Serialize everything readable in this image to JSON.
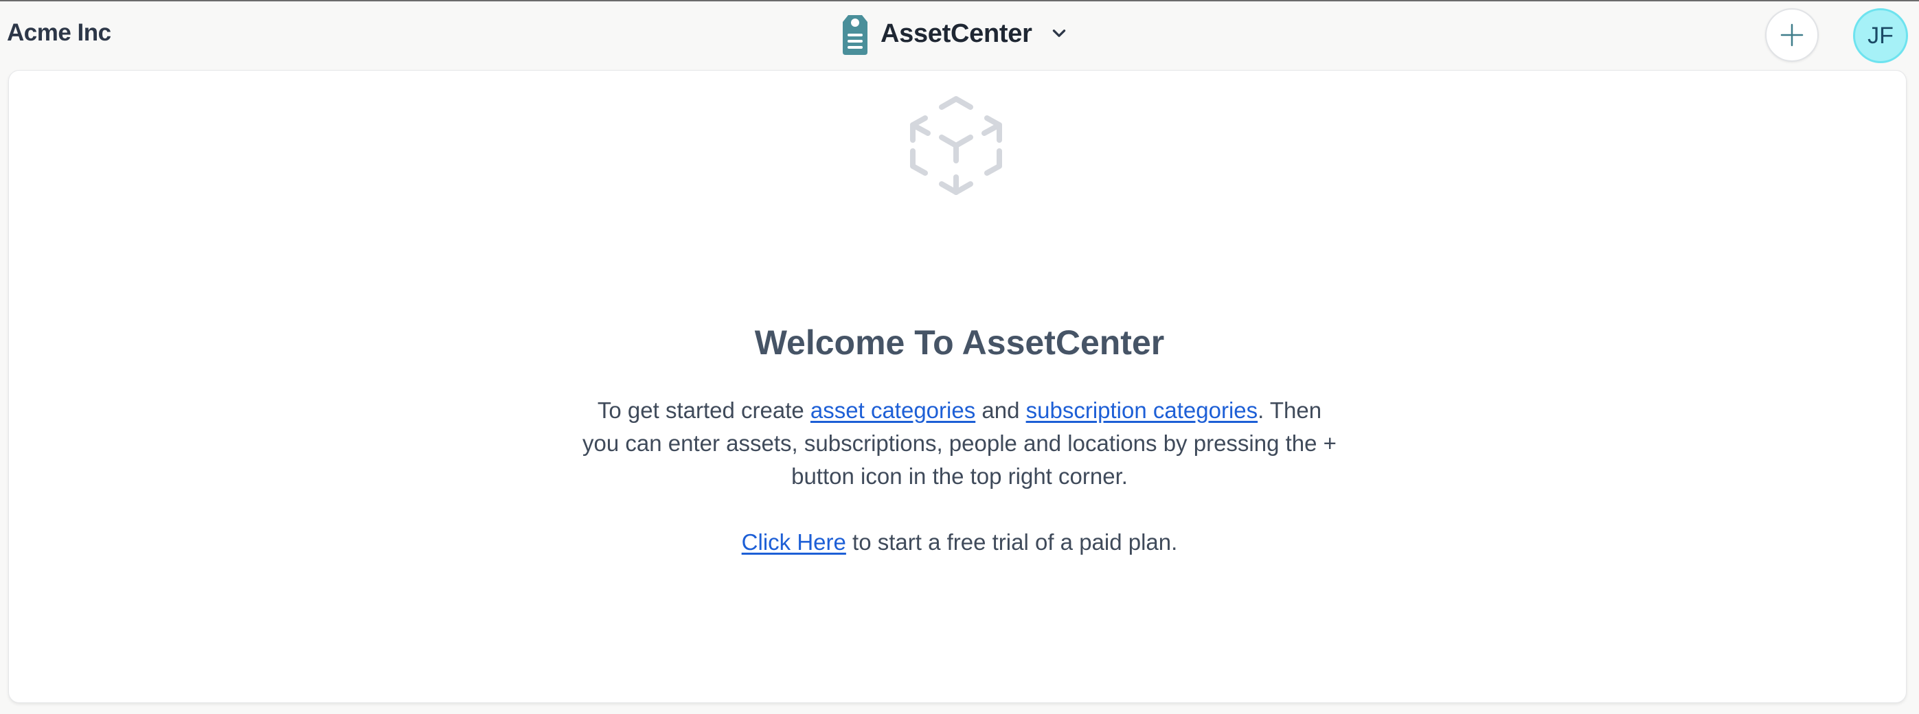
{
  "header": {
    "org_name": "Acme Inc",
    "app_name": "AssetCenter",
    "avatar_initials": "JF",
    "icons": {
      "app_logo": "tag-icon",
      "switcher": "chevron-down-icon",
      "add": "plus-icon"
    }
  },
  "main": {
    "empty_state_icon": "cube-icon",
    "title": "Welcome To AssetCenter",
    "intro": {
      "prefix": "To get started create ",
      "asset_categories_link": "asset categories",
      "conjunction": " and ",
      "subscription_categories_link": "subscription categories",
      "suffix": ". Then you can enter assets, subscriptions, people and locations by pressing the + button icon in the top right corner."
    },
    "trial": {
      "link": "Click Here",
      "suffix": " to start a free trial of a paid plan."
    }
  },
  "colors": {
    "accent_teal": "#4a8f9a",
    "link_blue": "#1d5fd6",
    "avatar_bg": "#a6f1f7",
    "text": "#3f4a5a"
  }
}
